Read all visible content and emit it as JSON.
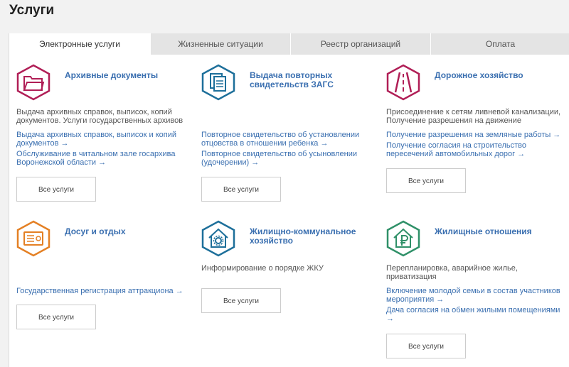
{
  "page": {
    "title": "Услуги"
  },
  "tabs": [
    {
      "label": "Электронные услуги",
      "active": true
    },
    {
      "label": "Жизненные ситуации",
      "active": false
    },
    {
      "label": "Реестр организаций",
      "active": false
    },
    {
      "label": "Оплата",
      "active": false
    }
  ],
  "colors": {
    "crimson": "#b01e56",
    "blue": "#1d6f9a",
    "orange": "#e48024",
    "green": "#2f9068",
    "link": "#3a6fb0"
  },
  "cards": [
    {
      "title": "Архивные документы",
      "icon": "folder-icon",
      "desc": "Выдача архивных справок, выписок, копий документов. Услуги государственных архивов",
      "links": [
        "Выдача архивных справок, выписок и копий документов →",
        "Обслуживание в читальном зале госархива Воронежской области →"
      ],
      "button": "Все услуги"
    },
    {
      "title": "Выдача повторных свидетельств ЗАГС",
      "icon": "documents-icon",
      "desc": "",
      "links": [
        "Повторное свидетельство об установлении отцовства в отношении ребенка →",
        "Повторное свидетельство об усыновлении (удочерении) →"
      ],
      "button": "Все услуги"
    },
    {
      "title": "Дорожное хозяйство",
      "icon": "road-icon",
      "desc": "Присоединение к сетям ливневой канализации, Получение разрешения на движение",
      "links": [
        "Получение разрешения на земляные работы →",
        "Получение согласия на строительство пересечений автомобильных дорог →"
      ],
      "button": "Все услуги"
    },
    {
      "title": "Досуг и отдых",
      "icon": "ticket-icon",
      "desc": "",
      "links": [
        "Государственная регистрация аттракциона →"
      ],
      "button": "Все услуги"
    },
    {
      "title": "Жилищно-коммунальное хозяйство",
      "icon": "house-gear-icon",
      "desc": "Информирование о порядке ЖКУ",
      "links": [],
      "button": "Все услуги"
    },
    {
      "title": "Жилищные отношения",
      "icon": "house-ruble-icon",
      "desc": "Перепланировка, аварийное жилье, приватизация",
      "links": [
        "Включение молодой семьи в состав участников мероприятия →",
        "Дача согласия на обмен жилыми помещениями →"
      ],
      "button": "Все услуги"
    }
  ]
}
